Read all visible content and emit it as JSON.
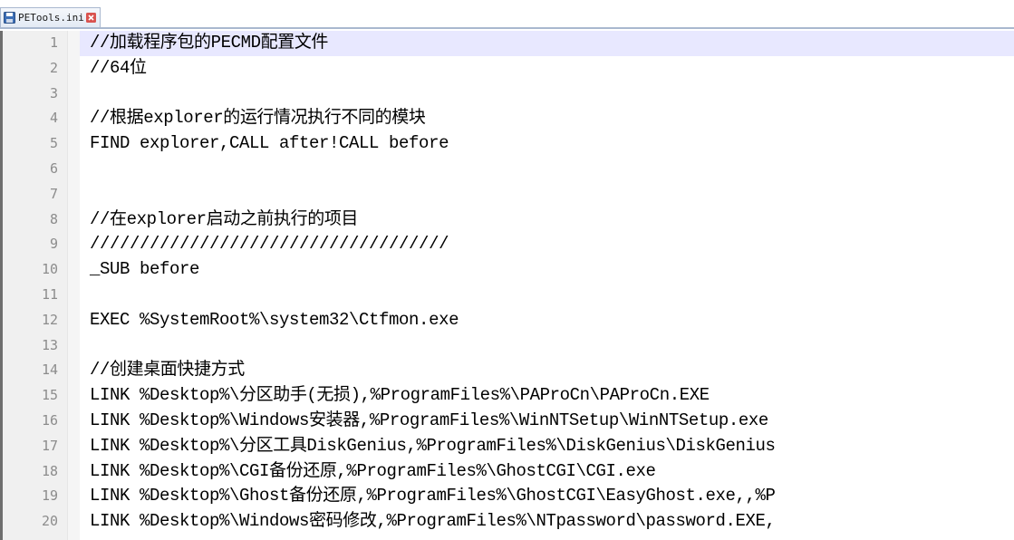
{
  "tab": {
    "title": "PETools.ini",
    "icon": "save-icon",
    "close_icon": "close-icon"
  },
  "editor": {
    "current_line": 1,
    "lines": [
      {
        "num": "1",
        "text": "//加载程序包的PECMD配置文件"
      },
      {
        "num": "2",
        "text": "//64位"
      },
      {
        "num": "3",
        "text": ""
      },
      {
        "num": "4",
        "text": "//根据explorer的运行情况执行不同的模块"
      },
      {
        "num": "5",
        "text": "FIND explorer,CALL after!CALL before"
      },
      {
        "num": "6",
        "text": ""
      },
      {
        "num": "7",
        "text": ""
      },
      {
        "num": "8",
        "text": "//在explorer启动之前执行的项目"
      },
      {
        "num": "9",
        "text": "////////////////////////////////////"
      },
      {
        "num": "10",
        "text": "_SUB before"
      },
      {
        "num": "11",
        "text": ""
      },
      {
        "num": "12",
        "text": "EXEC %SystemRoot%\\system32\\Ctfmon.exe"
      },
      {
        "num": "13",
        "text": ""
      },
      {
        "num": "14",
        "text": "//创建桌面快捷方式"
      },
      {
        "num": "15",
        "text": "LINK %Desktop%\\分区助手(无损),%ProgramFiles%\\PAProCn\\PAProCn.EXE"
      },
      {
        "num": "16",
        "text": "LINK %Desktop%\\Windows安装器,%ProgramFiles%\\WinNTSetup\\WinNTSetup.exe"
      },
      {
        "num": "17",
        "text": "LINK %Desktop%\\分区工具DiskGenius,%ProgramFiles%\\DiskGenius\\DiskGenius"
      },
      {
        "num": "18",
        "text": "LINK %Desktop%\\CGI备份还原,%ProgramFiles%\\GhostCGI\\CGI.exe"
      },
      {
        "num": "19",
        "text": "LINK %Desktop%\\Ghost备份还原,%ProgramFiles%\\GhostCGI\\EasyGhost.exe,,%P"
      },
      {
        "num": "20",
        "text": "LINK %Desktop%\\Windows密码修改,%ProgramFiles%\\NTpassword\\password.EXE,"
      }
    ]
  },
  "colors": {
    "current_line_bg": "#e8e8ff",
    "gutter_bg": "#f0f0f0",
    "line_number": "#8c8c8c",
    "text": "#000000",
    "tab_close": "#d9534f"
  }
}
